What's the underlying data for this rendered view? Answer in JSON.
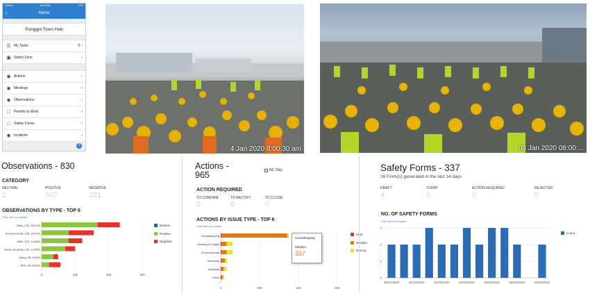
{
  "phone": {
    "status_left": "Online",
    "status_time": "8:04 PM",
    "status_right": "77%",
    "nav_title": "Home",
    "hub_name": "Punggol Town Hub",
    "group1": [
      {
        "label": "My Tasks",
        "count": "0",
        "icon": "checklist-icon"
      },
      {
        "label": "Select Zone",
        "count": "",
        "icon": "map-icon"
      }
    ],
    "group2": [
      {
        "label": "Actions",
        "icon": "eye-icon"
      },
      {
        "label": "Meetings",
        "icon": "eye-icon"
      },
      {
        "label": "Observations",
        "icon": "eye-icon"
      },
      {
        "label": "Permits to Work",
        "icon": "document-icon"
      },
      {
        "label": "Safety Forms",
        "icon": "document-icon"
      },
      {
        "label": "Incidents",
        "icon": "eye-icon"
      }
    ],
    "help_label": "?"
  },
  "photos": {
    "left_timestamp": "4 Jan 2020  8:00:30 am",
    "right_timestamp": "04 Jan 2020  08:00:..."
  },
  "observations": {
    "title": "Observations - 830",
    "category_heading": "CATEGORY",
    "stats": [
      {
        "label": "NEUTRAL",
        "value": "2"
      },
      {
        "label": "POSITIVE",
        "value": "507"
      },
      {
        "label": "NEGATIVE",
        "value": "321"
      }
    ],
    "chart_heading": "OBSERVATIONS BY TYPE - TOP 6",
    "expand_link": "Click here to expand",
    "legend": [
      "Neutral",
      "Positive",
      "Negative"
    ]
  },
  "actions": {
    "title_line1": "Actions -",
    "title_line2": "965",
    "nc_only_label": "NC Only",
    "required_heading": "ACTION REQUIRED",
    "stats": [
      {
        "label": "TO CONFIRM",
        "value": "0"
      },
      {
        "label": "TO RECTIFY",
        "value": "8"
      },
      {
        "label": "TO CLOSE",
        "value": "0"
      }
    ],
    "chart_heading": "ACTIONS BY ISSUE TYPE - TOP 6",
    "expand_link": "Click here to expand",
    "legend": [
      "High",
      "Medium",
      "Normal"
    ],
    "tooltip": {
      "title": "Housekeeping",
      "series": "Medium",
      "value": "337"
    }
  },
  "safety": {
    "title": "Safety Forms - 337",
    "subtitle": "26 Form(s) generated in the last 14 days",
    "stats": [
      {
        "label": "DRAFT",
        "value": "4"
      },
      {
        "label": "TODAY",
        "value": "0"
      },
      {
        "label": "ACTION REQUIRED",
        "value": "0"
      },
      {
        "label": "REJECTED",
        "value": "0"
      }
    ],
    "chart_heading": "NO. OF SAFETY FORMS",
    "expand_link": "Click here to expand",
    "legend": [
      "Count"
    ]
  },
  "colors": {
    "brand": "#2d7fd0",
    "neutral": "#2266aa",
    "positive": "#8cc63f",
    "negative": "#e8312c",
    "high": "#e8312c",
    "medium": "#e07a10",
    "normal": "#e8e320",
    "count": "#2a6db5"
  },
  "chart_data": [
    {
      "type": "bar",
      "orientation": "horizontal",
      "stacked": true,
      "categories": [
        "Other, 233, 28.07%",
        "Environmental, 155, 18.67%",
        "WAH, 121, 14.58%",
        "House Keeping, 100, 12.05%",
        "Lifting, 96, 6.99%",
        "PPE, 56, 6.53%"
      ],
      "series": [
        {
          "name": "Neutral",
          "values": [
            0,
            0,
            0,
            0,
            0,
            0
          ]
        },
        {
          "name": "Positive",
          "values": [
            166,
            80,
            80,
            70,
            35,
            22
          ]
        },
        {
          "name": "Negative",
          "values": [
            67,
            75,
            41,
            30,
            14,
            34
          ]
        }
      ],
      "xticks": [
        0,
        100,
        200,
        300
      ],
      "xlim": [
        0,
        300
      ]
    },
    {
      "type": "bar",
      "orientation": "horizontal",
      "stacked": true,
      "categories": [
        "Housekeeping",
        "Working At Height",
        "Environmental",
        "Electricity",
        "Scaffolds",
        "Other"
      ],
      "series": [
        {
          "name": "High",
          "values": [
            5,
            5,
            5,
            5,
            5,
            5
          ]
        },
        {
          "name": "Medium",
          "values": [
            337,
            25,
            25,
            17,
            10,
            5
          ]
        },
        {
          "name": "Normal",
          "values": [
            8,
            30,
            30,
            10,
            14,
            8
          ]
        }
      ],
      "xticks": [
        0,
        200,
        400,
        600
      ],
      "xlim": [
        0,
        600
      ]
    },
    {
      "type": "bar",
      "categories": [
        "29/01/2020",
        "30/01/2020",
        "31/01/2020",
        "01/02/2020",
        "02/02/2020",
        "03/02/2020",
        "04/02/2020",
        "05/02/2020",
        "06/02/2020",
        "07/02/2020",
        "08/02/2020",
        "09/02/2020",
        "10/02/2020"
      ],
      "xtick_labels": [
        "29/01/2020",
        "31/01/2020",
        "02/02/2020",
        "04/02/2020",
        "06/02/2020",
        "08/02/2020",
        "10/02/2020"
      ],
      "series": [
        {
          "name": "Count",
          "values": [
            2,
            2,
            2,
            3,
            2,
            2,
            3,
            2,
            3,
            3,
            2,
            0,
            2
          ]
        }
      ],
      "yticks": [
        0,
        1,
        2,
        3
      ],
      "ylim": [
        0,
        3
      ]
    }
  ]
}
